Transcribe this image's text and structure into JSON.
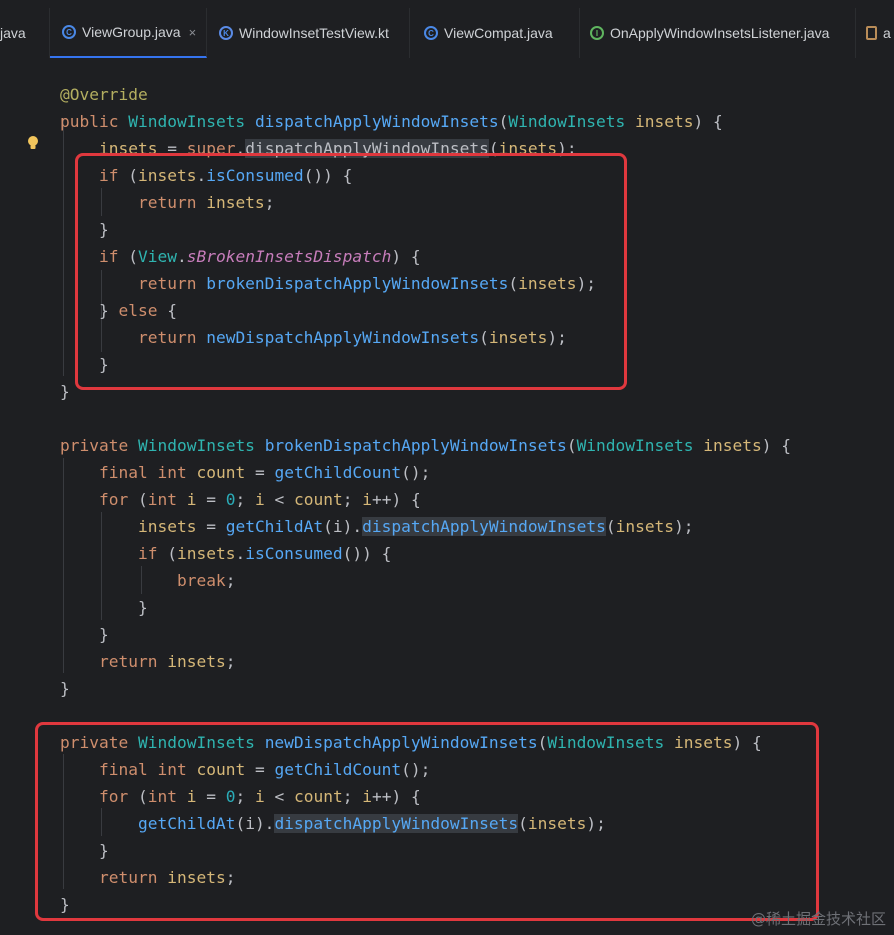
{
  "tabs": [
    {
      "label": "java",
      "icon": "none",
      "active": false
    },
    {
      "label": "ViewGroup.java",
      "icon": "class-icon",
      "active": true
    },
    {
      "label": "WindowInsetTestView.kt",
      "icon": "kotlin-class-icon",
      "active": false
    },
    {
      "label": "ViewCompat.java",
      "icon": "class-icon",
      "active": false
    },
    {
      "label": "OnApplyWindowInsetsListener.java",
      "icon": "interface-icon",
      "active": false
    },
    {
      "label": "a",
      "icon": "file-icon",
      "active": false
    }
  ],
  "tab_close_glyph": "×",
  "code": {
    "l1": "@Override",
    "l2_kw": "public",
    "l2_ty": "WindowInsets",
    "l2_fn": "dispatchApplyWindowInsets",
    "l2_ty2": "WindowInsets",
    "l2_pm": "insets",
    "l3_a": "insets",
    "l3_kw": "super",
    "l3_fn": "dispatchApplyWindowInsets",
    "l3_pm": "insets",
    "l4_kw": "if",
    "l4_pm": "insets",
    "l4_fn": "isConsumed",
    "l5_kw": "return",
    "l5_pm": "insets",
    "l7_kw": "if",
    "l7_ty": "View",
    "l7_fld": "sBrokenInsetsDispatch",
    "l8_kw": "return",
    "l8_fn": "brokenDispatchApplyWindowInsets",
    "l8_pm": "insets",
    "l9_kw": "else",
    "l10_kw": "return",
    "l10_fn": "newDispatchApplyWindowInsets",
    "l10_pm": "insets",
    "b1_kw": "private",
    "b1_ty": "WindowInsets",
    "b1_fn": "brokenDispatchApplyWindowInsets",
    "b1_ty2": "WindowInsets",
    "b1_pm": "insets",
    "b2_kw": "final",
    "b2_kw2": "int",
    "b2_v": "count",
    "b2_fn": "getChildCount",
    "b3_kw": "for",
    "b3_kw2": "int",
    "b3_v": "i",
    "b3_num": "0",
    "b3_v2": "i",
    "b3_v3": "count",
    "b3_v4": "i",
    "b4_pm": "insets",
    "b4_fn": "getChildAt",
    "b4_v": "i",
    "b4_fn2": "dispatchApplyWindowInsets",
    "b4_pm2": "insets",
    "b5_kw": "if",
    "b5_pm": "insets",
    "b5_fn": "isConsumed",
    "b6_kw": "break",
    "b9_kw": "return",
    "b9_pm": "insets",
    "c1_kw": "private",
    "c1_ty": "WindowInsets",
    "c1_fn": "newDispatchApplyWindowInsets",
    "c1_ty2": "WindowInsets",
    "c1_pm": "insets",
    "c2_kw": "final",
    "c2_kw2": "int",
    "c2_v": "count",
    "c2_fn": "getChildCount",
    "c3_kw": "for",
    "c3_kw2": "int",
    "c3_v": "i",
    "c3_num": "0",
    "c3_v2": "i",
    "c3_v3": "count",
    "c3_v4": "i",
    "c4_fn": "getChildAt",
    "c4_v": "i",
    "c4_fn2": "dispatchApplyWindowInsets",
    "c4_pm": "insets",
    "c6_kw": "return",
    "c6_pm": "insets"
  },
  "watermark": "@稀土掘金技术社区",
  "colors": {
    "keyword": "#cf8e6d",
    "type": "#2fb4b0",
    "method": "#56a8f5",
    "field": "#c77dbb",
    "highlight_box": "#e0383e"
  }
}
